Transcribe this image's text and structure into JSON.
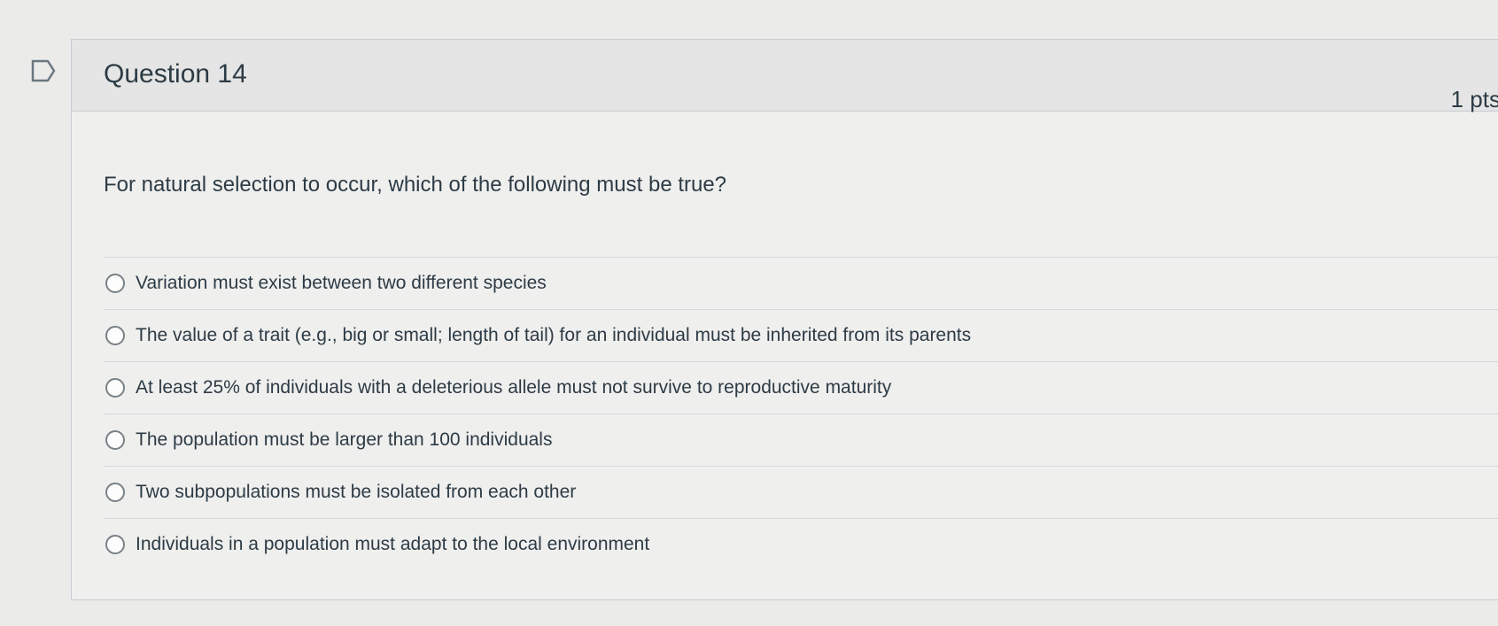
{
  "question": {
    "title": "Question 14",
    "points": "1 pts",
    "text": "For natural selection to occur, which of the following must be true?",
    "answers": [
      "Variation must exist between two different species",
      "The value of a trait (e.g., big or small; length of tail) for an individual must be inherited from its parents",
      "At least 25% of individuals with a deleterious allele must not survive to reproductive maturity",
      "The population must be larger than 100 individuals",
      "Two subpopulations must be isolated from each other",
      "Individuals in a population must adapt to the local environment"
    ]
  },
  "icons": {
    "flag": "flag-bookmark-icon"
  },
  "colors": {
    "text": "#2d3b45",
    "background": "#ebebea",
    "header": "#e4e5e4",
    "divider": "#c7cdd1"
  }
}
